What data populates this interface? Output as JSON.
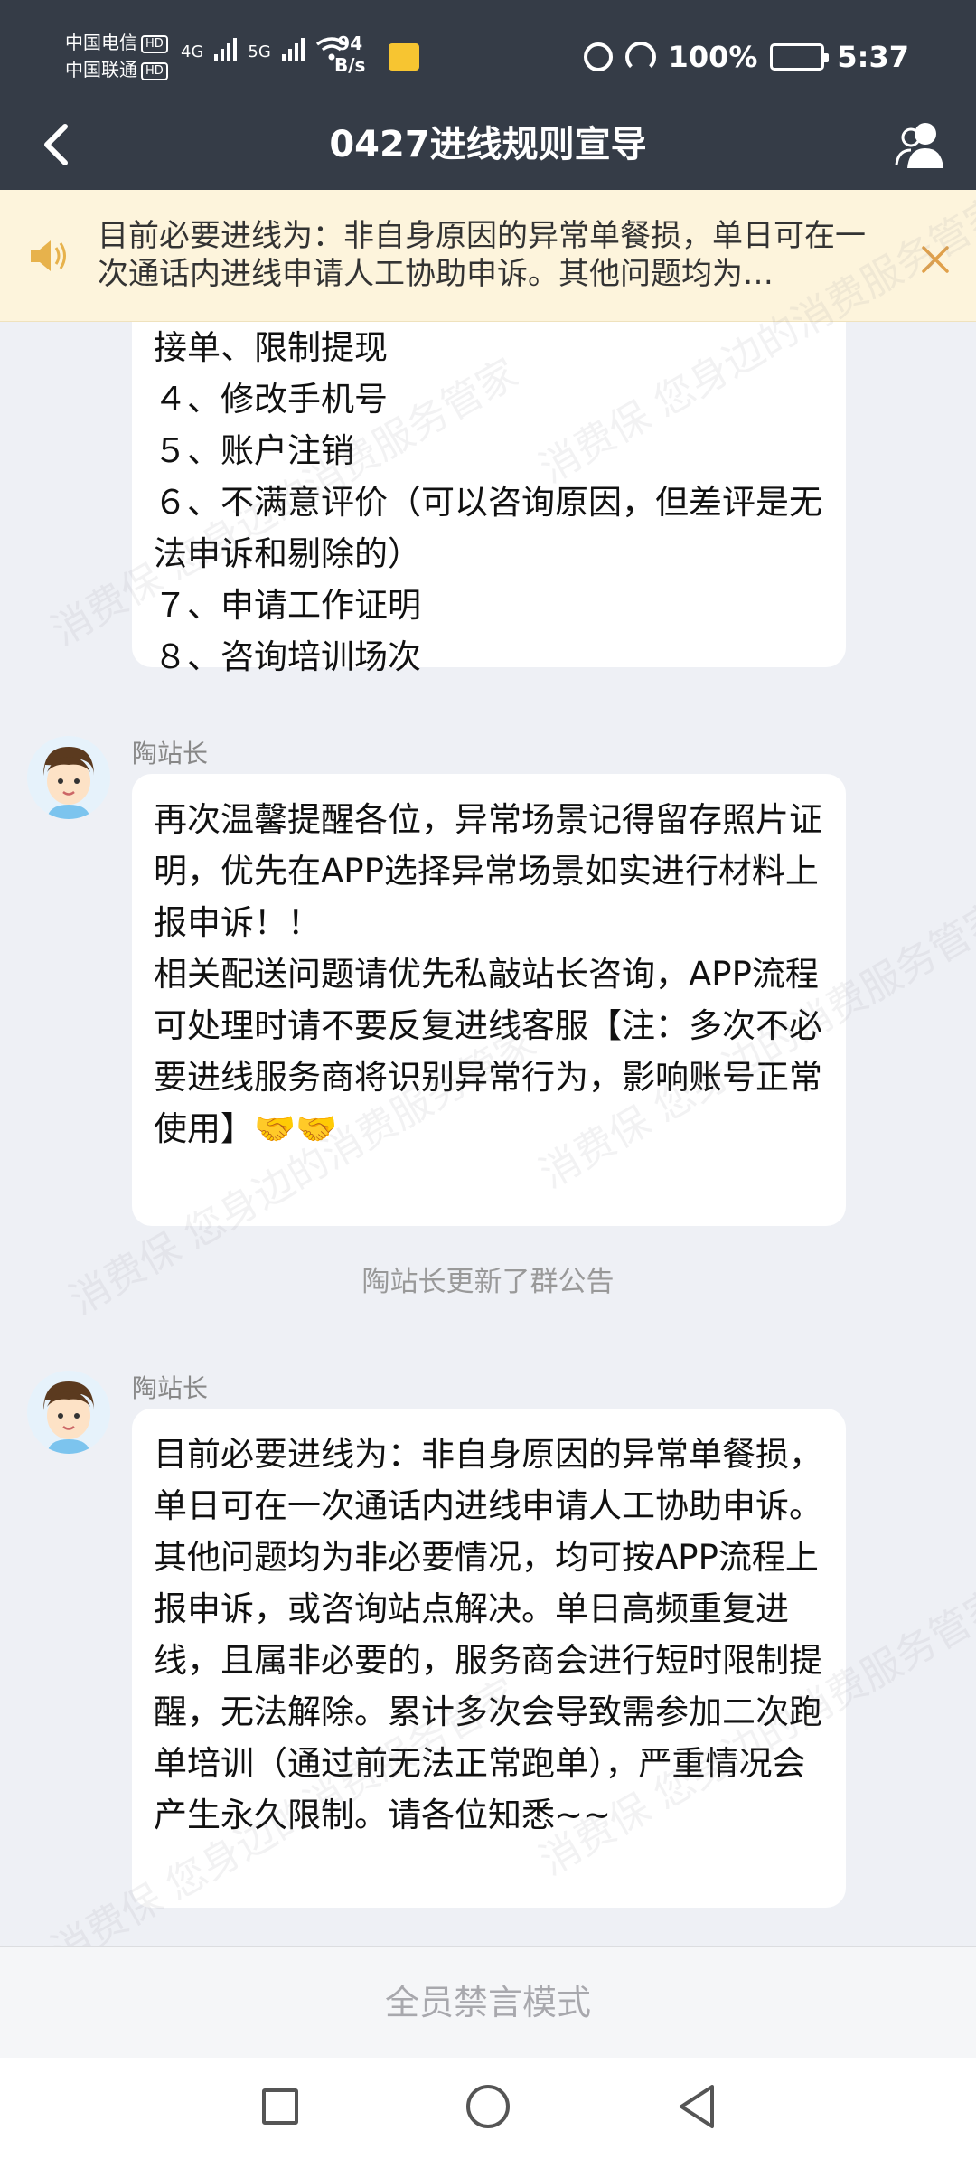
{
  "status_bar": {
    "carrier1": "中国电信",
    "carrier2": "中国联通",
    "hd": "HD",
    "net1": "4G",
    "net2": "5G",
    "speed_value": "94",
    "speed_unit": "B/s",
    "battery": "100%",
    "time": "5:37"
  },
  "header": {
    "title": "0427进线规则宣导"
  },
  "announcement": {
    "text": "目前必要进线为：非自身原因的异常单餐损，单日可在一次通话内进线申请人工协助申诉。其他问题均为…"
  },
  "messages": {
    "first": {
      "text": "接单、限制提现\n４、修改手机号\n５、账户注销\n６、不满意评价（可以咨询原因，但差评是无法申诉和剔除的）\n７、申请工作证明\n８、咨询培训场次"
    },
    "second": {
      "sender": "陶站长",
      "text": "再次温馨提醒各位，异常场景记得留存照片证明，优先在APP选择异常场景如实进行材料上报申诉！！\n相关配送问题请优先私敲站长咨询，APP流程可处理时请不要反复进线客服【注：多次不必要进线服务商将识别异常行为，影响账号正常使用】🤝🤝"
    },
    "system_note": "陶站长更新了群公告",
    "third": {
      "sender": "陶站长",
      "text": "目前必要进线为：非自身原因的异常单餐损，单日可在一次通话内进线申请人工协助申诉。其他问题均为非必要情况，均可按APP流程上报申诉，或咨询站点解决。单日高频重复进线，且属非必要的，服务商会进行短时限制提醒，无法解除。累计多次会导致需参加二次跑单培训（通过前无法正常跑单），严重情况会产生永久限制。请各位知悉~~"
    }
  },
  "footer": {
    "mute_text": "全员禁言模式"
  },
  "watermark": {
    "text": "消费保 您身边的消费服务管家"
  },
  "colors": {
    "header_bg": "#353c47",
    "banner_bg": "#fdf4dc",
    "chat_bg": "#eef0f5"
  }
}
